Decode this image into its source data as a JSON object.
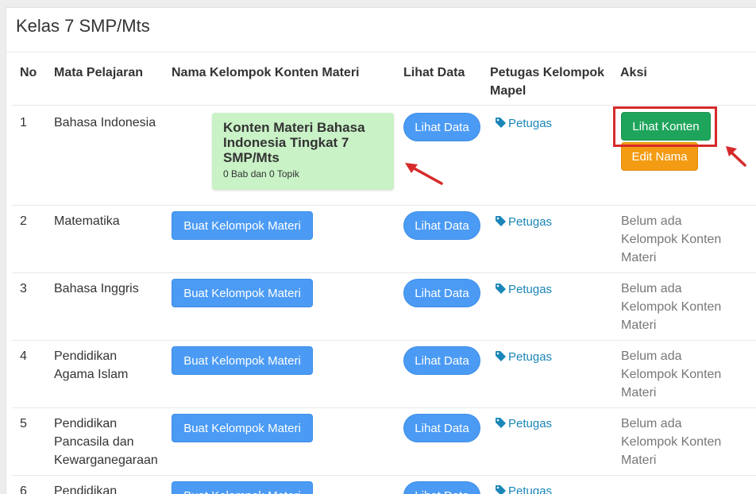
{
  "page": {
    "title": "Kelas 7 SMP/Mts"
  },
  "table": {
    "headers": {
      "no": "No",
      "mapel": "Mata Pelajaran",
      "kelompok": "Nama Kelompok Konten Materi",
      "lihat_data": "Lihat Data",
      "petugas_line1": "Petugas Kelompok",
      "petugas_line2": "Mapel",
      "aksi": "Aksi"
    },
    "rows": [
      {
        "no": "1",
        "mapel": [
          "Bahasa Indonesia"
        ],
        "card": {
          "title_lines": [
            "Konten Materi Bahasa",
            "Indonesia Tingkat 7",
            "SMP/Mts"
          ],
          "subtitle": "0 Bab dan 0 Topik"
        },
        "lihat_data": "Lihat Data",
        "petugas": "Petugas",
        "aksi_buttons": {
          "primary": "Lihat Konten",
          "secondary": "Edit Nama"
        }
      },
      {
        "no": "2",
        "mapel": [
          "Matematika"
        ],
        "create_button": "Buat Kelompok Materi",
        "lihat_data": "Lihat Data",
        "petugas": "Petugas",
        "aksi_text": [
          "Belum ada",
          "Kelompok Konten",
          "Materi"
        ]
      },
      {
        "no": "3",
        "mapel": [
          "Bahasa Inggris"
        ],
        "create_button": "Buat Kelompok Materi",
        "lihat_data": "Lihat Data",
        "petugas": "Petugas",
        "aksi_text": [
          "Belum ada",
          "Kelompok Konten",
          "Materi"
        ]
      },
      {
        "no": "4",
        "mapel": [
          "Pendidikan",
          "Agama Islam"
        ],
        "create_button": "Buat Kelompok Materi",
        "lihat_data": "Lihat Data",
        "petugas": "Petugas",
        "aksi_text": [
          "Belum ada",
          "Kelompok Konten",
          "Materi"
        ]
      },
      {
        "no": "5",
        "mapel": [
          "Pendidikan",
          "Pancasila dan",
          "Kewarganegaraan"
        ],
        "create_button": "Buat Kelompok Materi",
        "lihat_data": "Lihat Data",
        "petugas": "Petugas",
        "aksi_text": [
          "Belum ada",
          "Kelompok Konten",
          "Materi"
        ]
      },
      {
        "no": "6",
        "mapel": [
          "Pendidikan"
        ],
        "create_button": "Buat Kelompok Materi",
        "lihat_data": "Lihat Data",
        "petugas": "Petugas"
      }
    ]
  },
  "icons": {
    "tag": "tag-icon",
    "arrow": "red-arrow-icon"
  },
  "colors": {
    "blue_button": "#4b9bf5",
    "green_button": "#1fa55b",
    "orange_button": "#f39b13",
    "card_bg": "#c9f2c6",
    "link": "#1a86b8",
    "highlight_red": "#d62a2a"
  }
}
